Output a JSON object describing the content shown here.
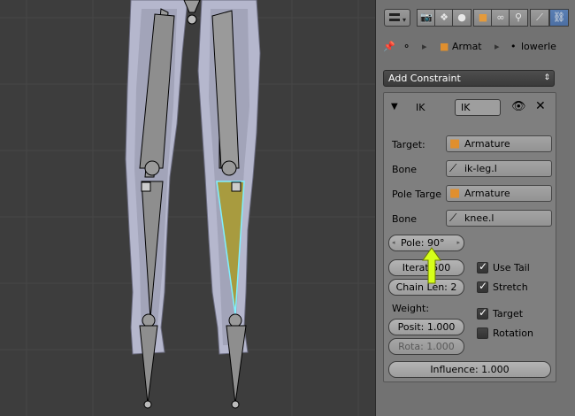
{
  "viewport": {
    "bg": "#3d3d3d",
    "mesh_color": "#b8b9cf",
    "bone_color": "#8e8e8e",
    "active_bone_color": "#a89b3f",
    "highlight": "#7ff0ff",
    "arrow_color": "#d6ff1a"
  },
  "properties": {
    "breadcrumb": {
      "armature_label": "Armat",
      "bone_label": "lowerle"
    },
    "add_constraint_label": "Add Constraint",
    "constraint": {
      "type_label": "IK",
      "name_value": "IK",
      "target_label": "Target:",
      "target_value": "Armature",
      "bone_label": "Bone",
      "bone_value": "ik-leg.l",
      "pole_target_label": "Pole Targe",
      "pole_target_value": "Armature",
      "pole_bone_label": "Bone",
      "pole_bone_value": "knee.l",
      "pole_angle": "Pole: 90°",
      "iterations": "Iterat 500",
      "chain_length": "Chain Len: 2",
      "use_tail_label": "Use Tail",
      "use_tail": true,
      "stretch_label": "Stretch",
      "stretch": true,
      "weight_label": "Weight:",
      "position_weight": "Posit: 1.000",
      "rotation_weight": "Rota: 1.000",
      "target_chk_label": "Target",
      "target_chk": true,
      "rotation_chk_label": "Rotation",
      "rotation_chk": false,
      "influence": "Influence: 1.000"
    }
  }
}
